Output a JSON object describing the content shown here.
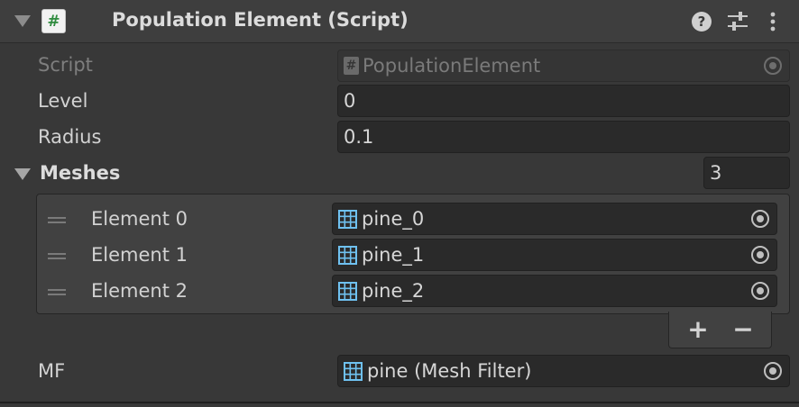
{
  "component": {
    "title": "Population Element (Script)",
    "script_icon": "#"
  },
  "fields": {
    "script": {
      "label": "Script",
      "value": "PopulationElement"
    },
    "level": {
      "label": "Level",
      "value": "0"
    },
    "radius": {
      "label": "Radius",
      "value": "0.1"
    },
    "meshes": {
      "label": "Meshes",
      "size": "3",
      "items": [
        {
          "label": "Element 0",
          "value": "pine_0"
        },
        {
          "label": "Element 1",
          "value": "pine_1"
        },
        {
          "label": "Element 2",
          "value": "pine_2"
        }
      ],
      "add_label": "+",
      "remove_label": "−"
    },
    "mf": {
      "label": "MF",
      "value": "pine (Mesh Filter)"
    }
  },
  "icons": {
    "foldout": "triangle-down-icon",
    "help": "question-circle-icon",
    "presets": "sliders-icon",
    "menu": "kebab-menu-icon",
    "object_picker": "target-icon",
    "mesh": "mesh-grid-icon"
  },
  "colors": {
    "background": "#383838",
    "header": "#3e3e3e",
    "field": "#2a2a2a",
    "mesh_icon": "#6fc1f0",
    "script_icon_green": "#2e8b3e"
  }
}
